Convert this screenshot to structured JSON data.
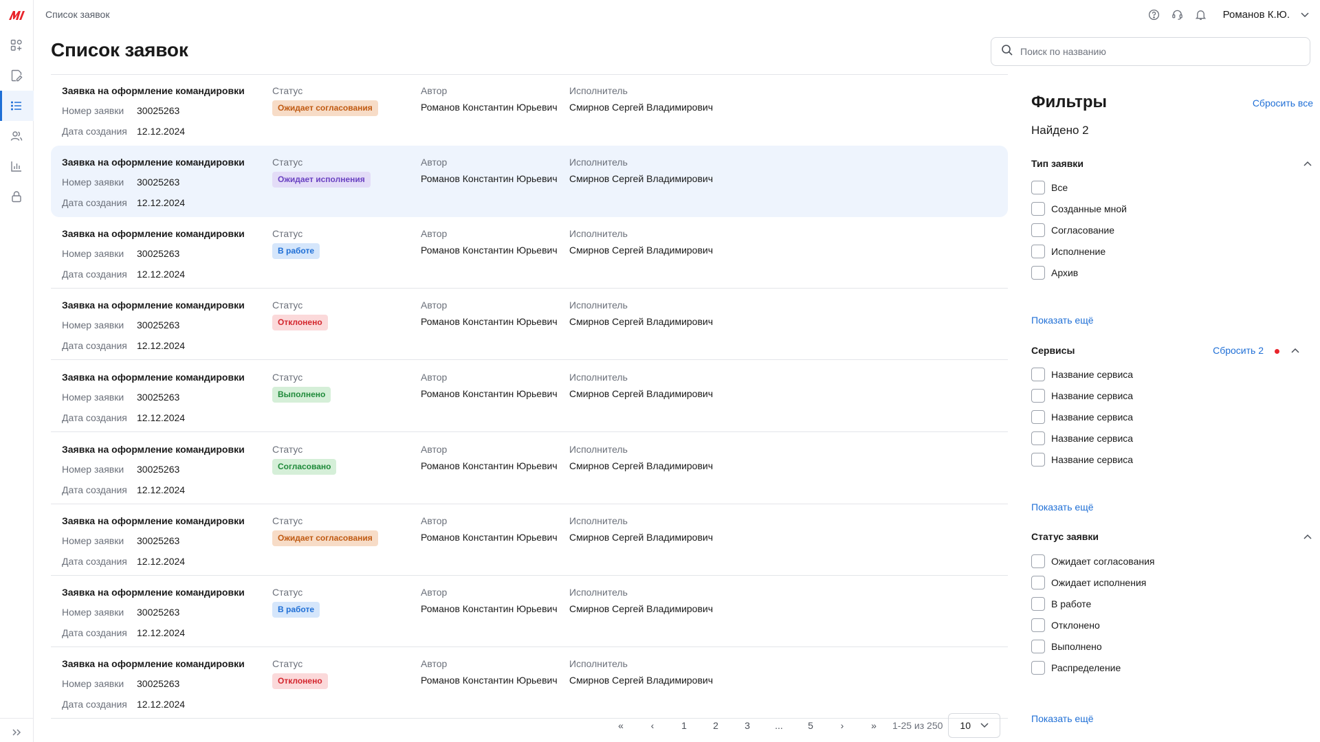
{
  "topbar": {
    "breadcrumb": "Список заявок",
    "user_name": "Романов К.Ю."
  },
  "page": {
    "title": "Список заявок"
  },
  "search": {
    "placeholder": "Поиск по названию"
  },
  "labels": {
    "number": "Номер заявки",
    "date": "Дата создания",
    "status": "Статус",
    "author": "Автор",
    "executor": "Исполнитель"
  },
  "requests": [
    {
      "title": "Заявка на оформление командировки",
      "number": "30025263",
      "date": "12.12.2024",
      "status": "Ожидает согласования",
      "status_color": "#f7dcc7",
      "status_text_color": "#c05a12",
      "author": "Романов Константин Юрьевич",
      "executor": "Смирнов Сергей Владимирович"
    },
    {
      "title": "Заявка на оформление командировки",
      "number": "30025263",
      "date": "12.12.2024",
      "status": "Ожидает исполнения",
      "status_color": "#e3dcf7",
      "status_text_color": "#6a42c2",
      "author": "Романов Константин Юрьевич",
      "executor": "Смирнов Сергей Владимирович"
    },
    {
      "title": "Заявка на оформление командировки",
      "number": "30025263",
      "date": "12.12.2024",
      "status": "В работе",
      "status_color": "#d5e6fb",
      "status_text_color": "#1f6fd6",
      "author": "Романов Константин Юрьевич",
      "executor": "Смирнов Сергей Владимирович"
    },
    {
      "title": "Заявка на оформление командировки",
      "number": "30025263",
      "date": "12.12.2024",
      "status": "Отклонено",
      "status_color": "#fbd9da",
      "status_text_color": "#d3262e",
      "author": "Романов Константин Юрьевич",
      "executor": "Смирнов Сергей Владимирович"
    },
    {
      "title": "Заявка на оформление командировки",
      "number": "30025263",
      "date": "12.12.2024",
      "status": "Выполнено",
      "status_color": "#d5efd8",
      "status_text_color": "#1f8a3a",
      "author": "Романов Константин Юрьевич",
      "executor": "Смирнов Сергей Владимирович"
    },
    {
      "title": "Заявка на оформление командировки",
      "number": "30025263",
      "date": "12.12.2024",
      "status": "Согласовано",
      "status_color": "#d5efd8",
      "status_text_color": "#1f8a3a",
      "author": "Романов Константин Юрьевич",
      "executor": "Смирнов Сергей Владимирович"
    },
    {
      "title": "Заявка на оформление командировки",
      "number": "30025263",
      "date": "12.12.2024",
      "status": "Ожидает согласования",
      "status_color": "#f7dcc7",
      "status_text_color": "#c05a12",
      "author": "Романов Константин Юрьевич",
      "executor": "Смирнов Сергей Владимирович"
    },
    {
      "title": "Заявка на оформление командировки",
      "number": "30025263",
      "date": "12.12.2024",
      "status": "В работе",
      "status_color": "#d5e6fb",
      "status_text_color": "#1f6fd6",
      "author": "Романов Константин Юрьевич",
      "executor": "Смирнов Сергей Владимирович"
    },
    {
      "title": "Заявка на оформление командировки",
      "number": "30025263",
      "date": "12.12.2024",
      "status": "Отклонено",
      "status_color": "#fbd9da",
      "status_text_color": "#d3262e",
      "author": "Романов Константин Юрьевич",
      "executor": "Смирнов Сергей Владимирович"
    }
  ],
  "pagination": {
    "first": "«",
    "prev": "‹",
    "pages": [
      "1",
      "2",
      "3",
      "...",
      "5"
    ],
    "next": "›",
    "last": "»",
    "info": "1-25 из 250",
    "page_size": "10"
  },
  "filters": {
    "title": "Фильтры",
    "reset_all": "Сбросить все",
    "found": "Найдено 2",
    "type": {
      "title": "Тип заявки",
      "items": [
        "Все",
        "Созданные мной",
        "Согласование",
        "Исполнение",
        "Архив"
      ],
      "more": "Показать ещё"
    },
    "services": {
      "title": "Сервисы",
      "reset": "Сбросить 2",
      "items": [
        "Название сервиса",
        "Название сервиса",
        "Название сервиса",
        "Название сервиса",
        "Название сервиса"
      ],
      "more": "Показать ещё"
    },
    "status": {
      "title": "Статус заявки",
      "items": [
        "Ожидает согласования",
        "Ожидает исполнения",
        "В работе",
        "Отклонено",
        "Выполнено",
        "Распределение"
      ],
      "more": "Показать ещё"
    }
  },
  "sidebar": {
    "items": [
      "widgets-icon",
      "document-edit-icon",
      "list-icon",
      "users-icon",
      "chart-icon",
      "lock-icon"
    ],
    "active": "list-icon"
  },
  "colors": {
    "accent": "#1f6fd6",
    "logo": "#e8242b",
    "highlight_row": "#eef4fd"
  }
}
